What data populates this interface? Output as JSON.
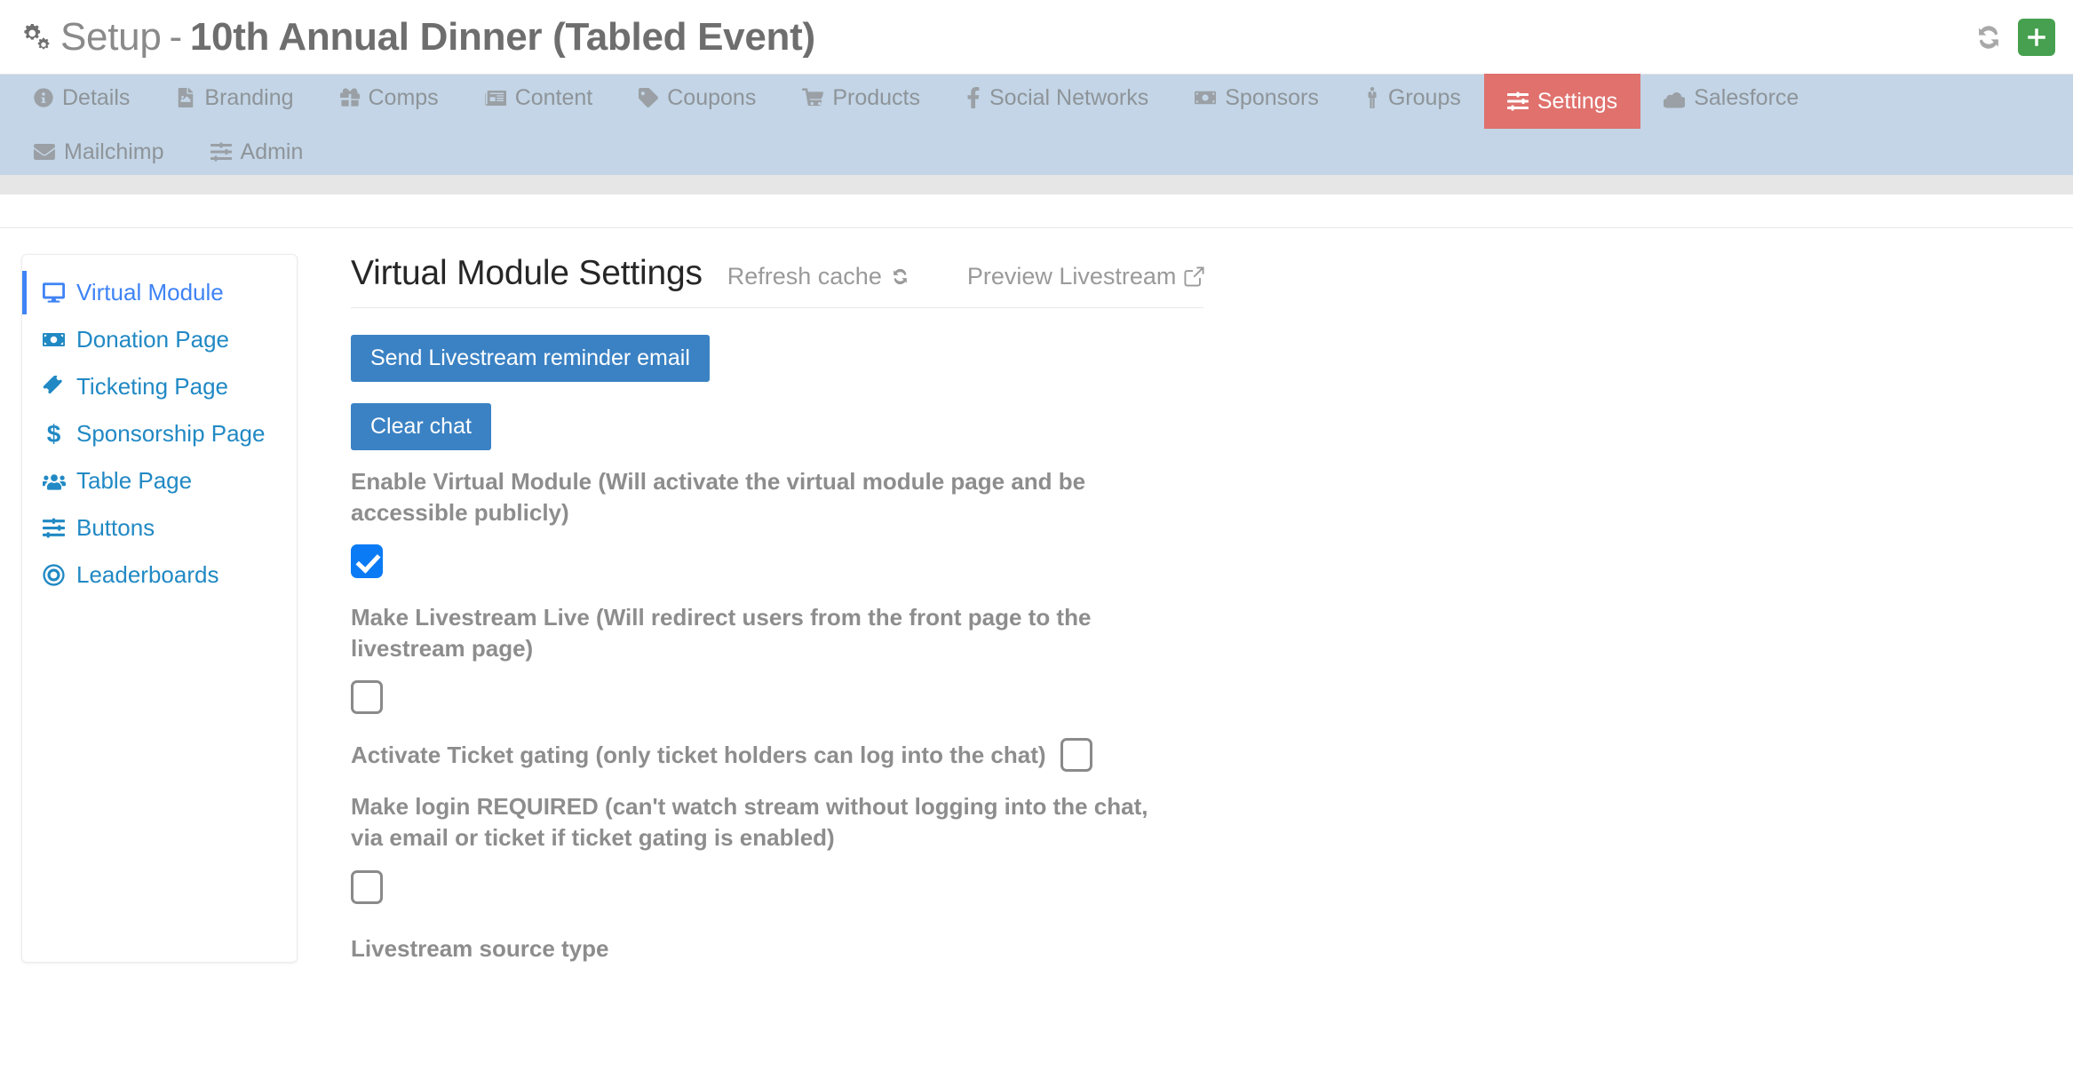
{
  "header": {
    "icon": "gears-icon",
    "setup_word": "Setup",
    "dash": "-",
    "event_name": "10th Annual Dinner (Tabled Event)",
    "refresh_icon": "refresh-sync-icon",
    "add_icon": "plus-icon"
  },
  "nav": {
    "active_color": "#e0716d",
    "bar_color": "#c3d5e6",
    "items": [
      {
        "label": "Details",
        "icon": "info-circle-icon",
        "active": false
      },
      {
        "label": "Branding",
        "icon": "image-file-icon",
        "active": false
      },
      {
        "label": "Comps",
        "icon": "gift-icon",
        "active": false
      },
      {
        "label": "Content",
        "icon": "newspaper-icon",
        "active": false
      },
      {
        "label": "Coupons",
        "icon": "tag-icon",
        "active": false
      },
      {
        "label": "Products",
        "icon": "shopping-cart-icon",
        "active": false
      },
      {
        "label": "Social Networks",
        "icon": "facebook-f-icon",
        "active": false
      },
      {
        "label": "Sponsors",
        "icon": "money-bill-icon",
        "active": false
      },
      {
        "label": "Groups",
        "icon": "person-icon",
        "active": false
      },
      {
        "label": "Settings",
        "icon": "sliders-icon",
        "active": true
      },
      {
        "label": "Salesforce",
        "icon": "cloud-icon",
        "active": false
      },
      {
        "label": "Mailchimp",
        "icon": "envelope-icon",
        "active": false
      },
      {
        "label": "Admin",
        "icon": "sliders-icon",
        "active": false
      }
    ]
  },
  "sidebar": {
    "active_color": "#3f83f5",
    "link_color": "#2189c4",
    "items": [
      {
        "label": "Virtual Module",
        "icon": "desktop-icon",
        "active": true
      },
      {
        "label": "Donation Page",
        "icon": "money-bill-icon",
        "active": false
      },
      {
        "label": "Ticketing Page",
        "icon": "ticket-icon",
        "active": false
      },
      {
        "label": "Sponsorship Page",
        "icon": "dollar-sign-icon",
        "active": false
      },
      {
        "label": "Table Page",
        "icon": "users-icon",
        "active": false
      },
      {
        "label": "Buttons",
        "icon": "sliders-icon",
        "active": false
      },
      {
        "label": "Leaderboards",
        "icon": "bullseye-icon",
        "active": false
      }
    ]
  },
  "main": {
    "title": "Virtual Module Settings",
    "refresh_cache_label": "Refresh cache",
    "refresh_cache_icon": "refresh-sync-icon",
    "preview_livestream_label": "Preview Livestream",
    "preview_livestream_icon": "external-link-icon",
    "send_reminder_button": "Send Livestream reminder email",
    "clear_chat_button": "Clear chat",
    "button_color": "#3b82c4",
    "fields": [
      {
        "label": "Enable Virtual Module (Will activate the virtual module page and be accessible publicly)",
        "checked": true
      },
      {
        "label": "Make Livestream Live (Will redirect users from the front page to the livestream page)",
        "checked": false
      },
      {
        "label": "Activate Ticket gating (only ticket holders can log into the chat)",
        "checked": false
      },
      {
        "label": "Make login REQUIRED (can't watch stream without logging into the chat, via email or ticket if ticket gating is enabled)",
        "checked": false
      }
    ],
    "truncated_field_label": "Livestream source type"
  }
}
